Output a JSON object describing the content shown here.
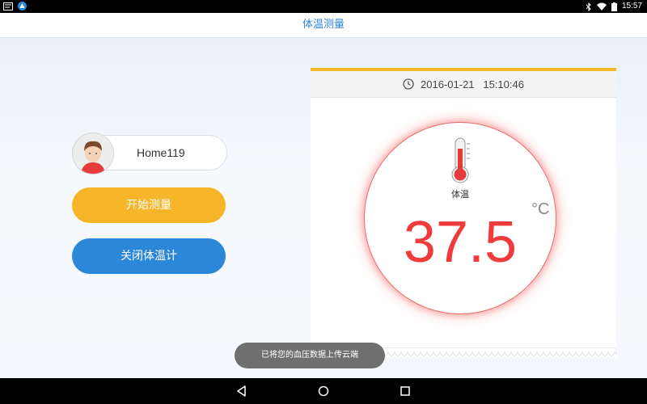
{
  "status_bar": {
    "time": "15:57",
    "left_icons": [
      "notification-icon",
      "app-icon"
    ],
    "right_icons": [
      "bluetooth-icon",
      "wifi-icon",
      "battery-icon"
    ]
  },
  "header": {
    "title": "体温测量"
  },
  "user": {
    "name": "Home119"
  },
  "buttons": {
    "start": "开始测量",
    "close": "关闭体温计"
  },
  "reading": {
    "datetime": "2016-01-21   15:10:46",
    "label": "体温",
    "value": "37.5",
    "unit": "°C"
  },
  "toast": {
    "message": "已将您的血压数据上传云端"
  },
  "colors": {
    "accent_blue": "#2d87d8",
    "accent_yellow": "#f7b52a",
    "temp_red": "#ef3b3b"
  },
  "nav": {
    "icons": [
      "back-icon",
      "home-icon",
      "recents-icon"
    ]
  }
}
